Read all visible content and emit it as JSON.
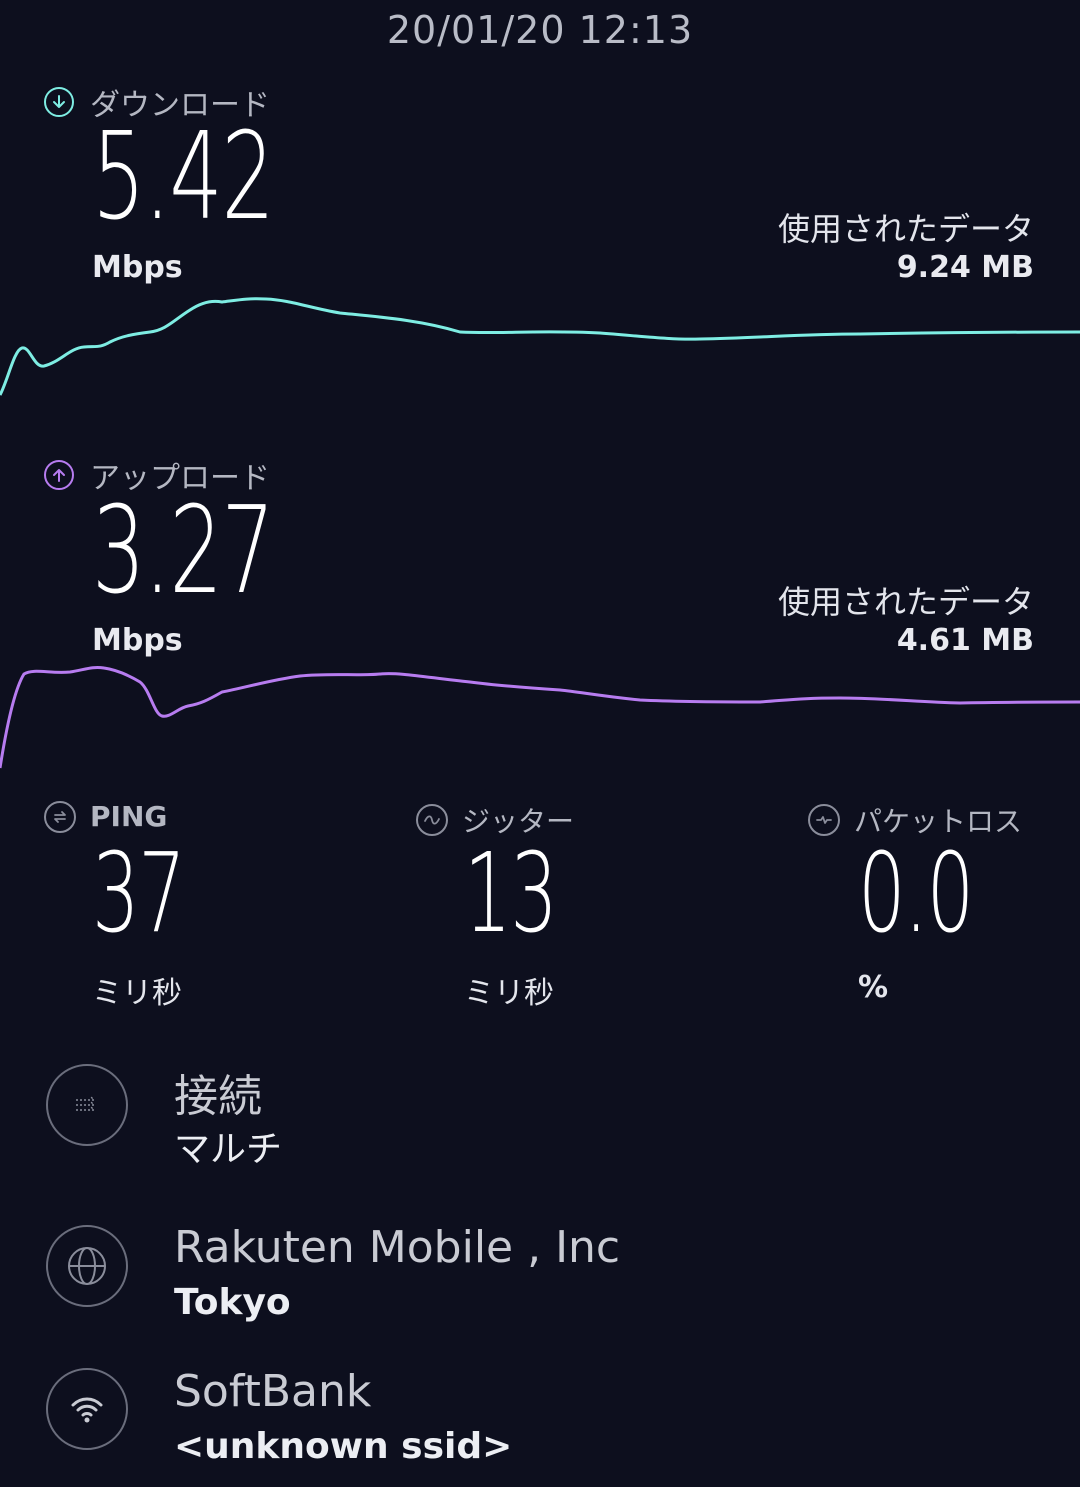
{
  "timestamp": "20/01/20 12:13",
  "download": {
    "label": "ダウンロード",
    "value": "5.42",
    "unit": "Mbps",
    "data_used_label": "使用されたデータ",
    "data_used_value": "9.24 MB",
    "color": "#7eede3"
  },
  "upload": {
    "label": "アップロード",
    "value": "3.27",
    "unit": "Mbps",
    "data_used_label": "使用されたデータ",
    "data_used_value": "4.61 MB",
    "color": "#b77cf0"
  },
  "ping": {
    "label": "PING",
    "value": "37",
    "unit": "ミリ秒"
  },
  "jitter": {
    "label": "ジッター",
    "value": "13",
    "unit": "ミリ秒"
  },
  "packet_loss": {
    "label": "パケットロス",
    "value": "0.0",
    "unit": "%"
  },
  "connection": {
    "title": "接続",
    "value": "マルチ",
    "icon": "multi-connection-icon"
  },
  "provider": {
    "name": "Rakuten Mobile , Inc",
    "server": "Tokyo",
    "icon": "globe-icon"
  },
  "network": {
    "name": "SoftBank",
    "ssid": "<unknown ssid>",
    "icon": "wifi-icon"
  }
}
